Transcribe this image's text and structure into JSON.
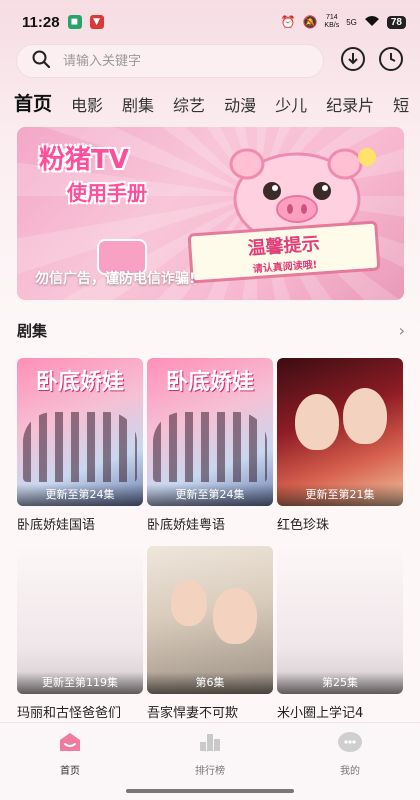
{
  "status_bar": {
    "time": "11:28",
    "net_speed_value": "714",
    "net_speed_unit": "KB/s",
    "signal": "5G",
    "battery": "78"
  },
  "search": {
    "placeholder": "请输入关键字"
  },
  "icons": {
    "search": "search-icon",
    "download": "download-icon",
    "history": "clock-icon"
  },
  "tabs": [
    {
      "label": "首页",
      "active": true
    },
    {
      "label": "电影"
    },
    {
      "label": "剧集"
    },
    {
      "label": "综艺"
    },
    {
      "label": "动漫"
    },
    {
      "label": "少儿"
    },
    {
      "label": "纪录片"
    },
    {
      "label": "短"
    }
  ],
  "banner": {
    "title_line1": "粉猪TV",
    "title_line2": "使用手册",
    "notice_title": "温馨提示",
    "notice_sub": "请认真阅读哦!",
    "caption": "勿信广告，谨防电信诈骗!"
  },
  "section": {
    "title": "剧集",
    "more": "›"
  },
  "cards": [
    {
      "name": "卧底娇娃国语",
      "badge": "更新至第24集",
      "poster_text": "卧底娇娃"
    },
    {
      "name": "卧底娇娃粤语",
      "badge": "更新至第24集",
      "poster_text": "卧底娇娃"
    },
    {
      "name": "红色珍珠",
      "badge": "更新至第21集"
    },
    {
      "name": "玛丽和古怪爸爸们",
      "badge": "更新至第119集"
    },
    {
      "name": "吾家悍妻不可欺",
      "badge": "第6集"
    },
    {
      "name": "米小圈上学记4",
      "badge": "第25集"
    }
  ],
  "bottom_nav": [
    {
      "label": "首页",
      "icon": "home-icon",
      "active": true
    },
    {
      "label": "排行榜",
      "icon": "ranking-icon"
    },
    {
      "label": "我的",
      "icon": "profile-icon"
    }
  ],
  "colors": {
    "accent": "#ff4f9a",
    "home_active": "#f07aa0"
  }
}
